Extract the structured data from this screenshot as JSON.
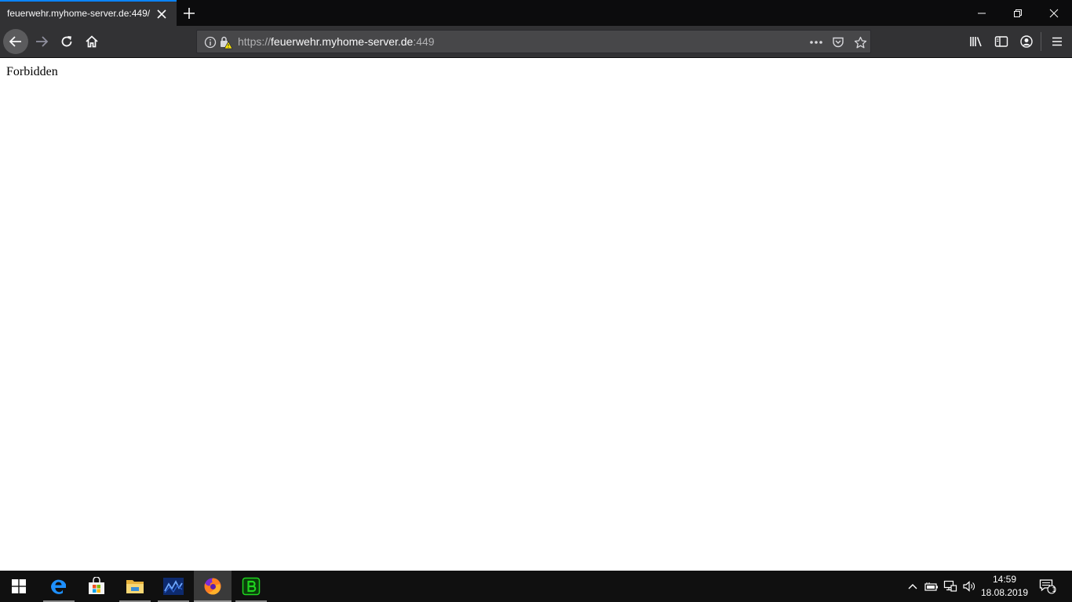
{
  "browser": {
    "tab": {
      "title": "feuerwehr.myhome-server.de:449/"
    },
    "url": {
      "scheme": "https://",
      "host": "feuerwehr.myhome-server.de",
      "port": ":449"
    },
    "accent_color": "#0a84ff",
    "toolbar_icons": [
      "back-icon",
      "forward-icon",
      "reload-icon",
      "home-icon",
      "info-icon",
      "insecure-lock-icon",
      "page-actions-icon",
      "pocket-icon",
      "bookmark-star-icon",
      "library-icon",
      "sidebar-icon",
      "account-icon",
      "menu-icon"
    ]
  },
  "page": {
    "text": "Forbidden"
  },
  "taskbar": {
    "apps": [
      "start-icon",
      "edge-icon",
      "store-icon",
      "file-explorer-icon",
      "stock-chart-app-icon",
      "firefox-icon",
      "green-b-app-icon"
    ],
    "clock": {
      "time": "14:59",
      "date": "18.08.2019"
    },
    "notification_count": "1"
  }
}
